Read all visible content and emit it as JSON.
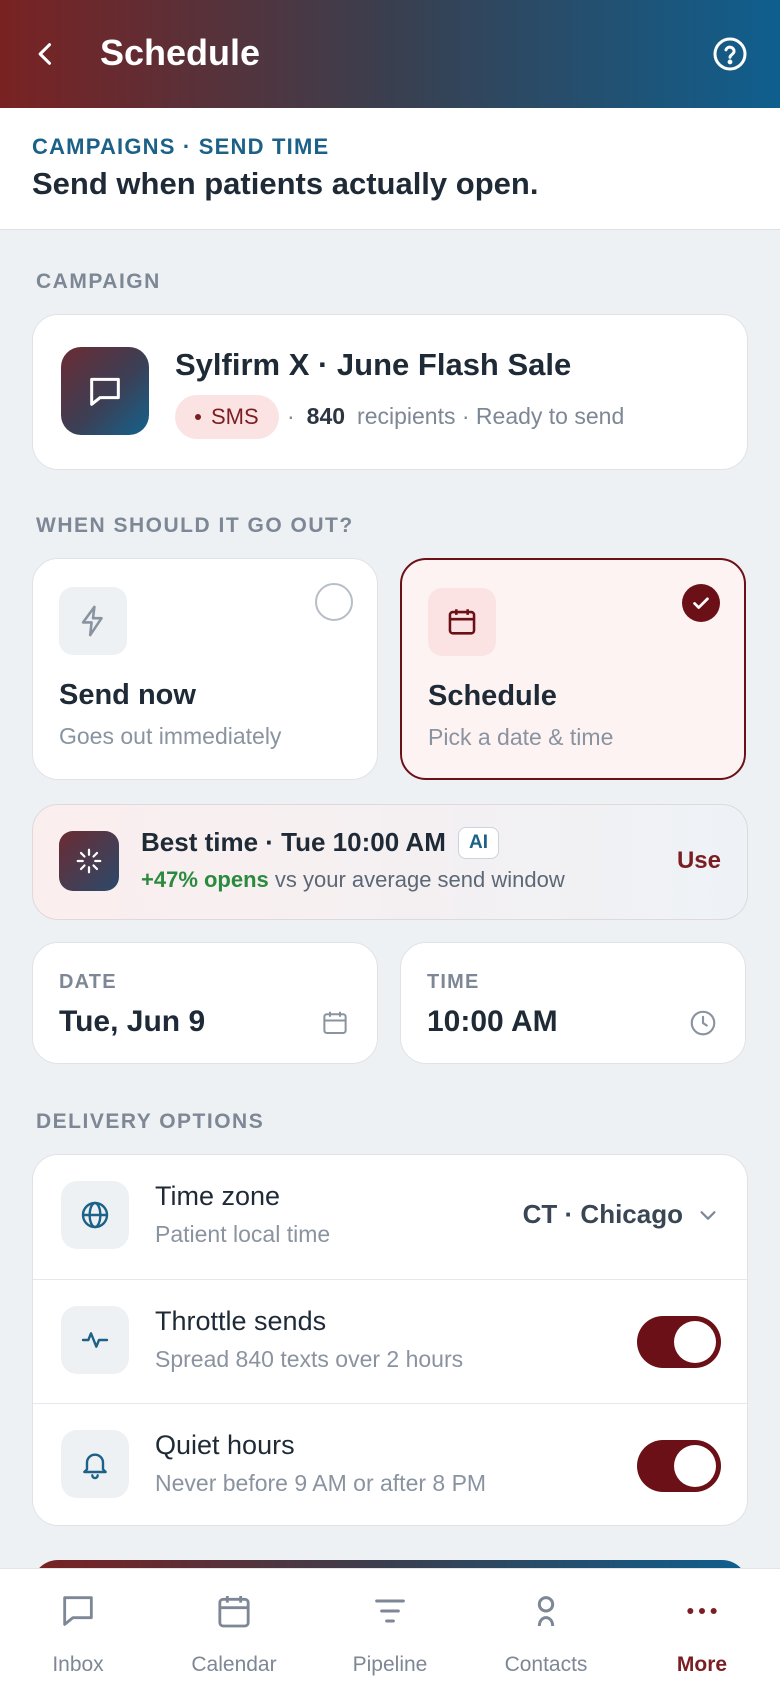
{
  "header": {
    "title": "Schedule"
  },
  "subhead": {
    "kicker": "CAMPAIGNS · SEND TIME",
    "headline": "Send when patients actually open."
  },
  "campaign": {
    "section_label": "CAMPAIGN",
    "name": "Sylfirm X · June Flash Sale",
    "channel": "SMS",
    "recipients": "840",
    "status": "recipients · Ready to send"
  },
  "when": {
    "section_label": "WHEN SHOULD IT GO OUT?",
    "options": [
      {
        "title": "Send now",
        "subtitle": "Goes out immediately",
        "selected": false
      },
      {
        "title": "Schedule",
        "subtitle": "Pick a date & time",
        "selected": true
      }
    ]
  },
  "best_time": {
    "title": "Best time · Tue 10:00 AM",
    "badge": "AI",
    "uplift": "+47% opens",
    "detail": "vs your average send window",
    "action": "Use"
  },
  "date": {
    "label": "DATE",
    "value": "Tue, Jun 9"
  },
  "time": {
    "label": "TIME",
    "value": "10:00 AM"
  },
  "delivery": {
    "section_label": "DELIVERY OPTIONS",
    "timezone": {
      "title": "Time zone",
      "subtitle": "Patient local time",
      "value": "CT · Chicago"
    },
    "throttle": {
      "title": "Throttle sends",
      "subtitle": "Spread 840 texts over 2 hours",
      "enabled": true
    },
    "quiet": {
      "title": "Quiet hours",
      "subtitle": "Never before 9 AM or after 8 PM",
      "enabled": true
    }
  },
  "nav": {
    "items": [
      {
        "label": "Inbox",
        "icon": "chat-icon"
      },
      {
        "label": "Calendar",
        "icon": "calendar-icon"
      },
      {
        "label": "Pipeline",
        "icon": "filter-icon"
      },
      {
        "label": "Contacts",
        "icon": "person-icon"
      },
      {
        "label": "More",
        "icon": "more-icon",
        "active": true
      }
    ]
  },
  "colors": {
    "brand_red": "#6b1016",
    "brand_blue": "#0f5f8e",
    "accent_green": "#2a8a3e"
  }
}
